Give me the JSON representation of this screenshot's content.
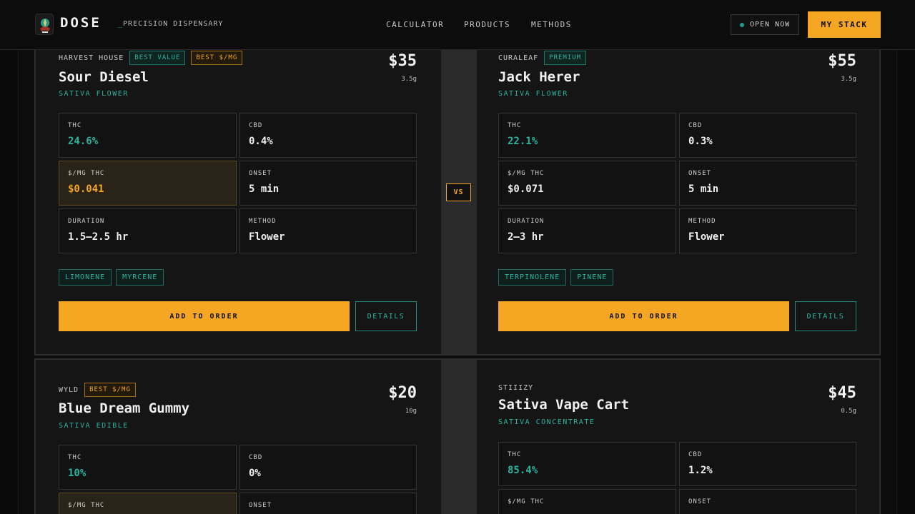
{
  "header": {
    "brand": "DOSE",
    "tagline_prefix": "_",
    "tagline": "PRECISION DISPENSARY",
    "nav": [
      "CALCULATOR",
      "PRODUCTS",
      "METHODS"
    ],
    "status": "OPEN NOW",
    "cta": "MY STACK"
  },
  "vs_label": "VS",
  "comparisons": [
    {
      "left": {
        "brand": "HARVEST HOUSE",
        "badges": [
          "BEST VALUE",
          "BEST $/MG"
        ],
        "name": "Sour Diesel",
        "category": "SATIVA FLOWER",
        "price": "$35",
        "weight": "3.5g",
        "stats": [
          {
            "label": "THC",
            "value": "24.6%"
          },
          {
            "label": "CBD",
            "value": "0.4%"
          },
          {
            "label": "$/MG THC",
            "value": "$0.041"
          },
          {
            "label": "ONSET",
            "value": "5 min"
          },
          {
            "label": "DURATION",
            "value": "1.5–2.5 hr"
          },
          {
            "label": "METHOD",
            "value": "Flower"
          }
        ],
        "terpenes": [
          "LIMONENE",
          "MYRCENE"
        ],
        "add_label": "ADD TO ORDER",
        "details_label": "DETAILS"
      },
      "right": {
        "brand": "CURALEAF",
        "badges": [
          "PREMIUM"
        ],
        "name": "Jack Herer",
        "category": "SATIVA FLOWER",
        "price": "$55",
        "weight": "3.5g",
        "stats": [
          {
            "label": "THC",
            "value": "22.1%"
          },
          {
            "label": "CBD",
            "value": "0.3%"
          },
          {
            "label": "$/MG THC",
            "value": "$0.071"
          },
          {
            "label": "ONSET",
            "value": "5 min"
          },
          {
            "label": "DURATION",
            "value": "2–3 hr"
          },
          {
            "label": "METHOD",
            "value": "Flower"
          }
        ],
        "terpenes": [
          "TERPINOLENE",
          "PINENE"
        ],
        "add_label": "ADD TO ORDER",
        "details_label": "DETAILS"
      }
    },
    {
      "left": {
        "brand": "WYLD",
        "badges": [
          "BEST $/MG"
        ],
        "name": "Blue Dream Gummy",
        "category": "SATIVA EDIBLE",
        "price": "$20",
        "weight": "10g",
        "stats": [
          {
            "label": "THC",
            "value": "10%"
          },
          {
            "label": "CBD",
            "value": "0%"
          },
          {
            "label": "$/MG THC",
            "value": ""
          },
          {
            "label": "ONSET",
            "value": ""
          }
        ]
      },
      "right": {
        "brand": "STIIIZY",
        "name": "Sativa Vape Cart",
        "category": "SATIVA CONCENTRATE",
        "price": "$45",
        "weight": "0.5g",
        "stats": [
          {
            "label": "THC",
            "value": "85.4%"
          },
          {
            "label": "CBD",
            "value": "1.2%"
          },
          {
            "label": "$/MG THC",
            "value": ""
          },
          {
            "label": "ONSET",
            "value": ""
          }
        ]
      }
    }
  ],
  "colors": {
    "accent": "#f5a623",
    "teal": "#2bb3a0",
    "background": "#0c0c0c",
    "card": "#151515"
  },
  "icons": {
    "logo": "cannabis-leaf-emblem-icon",
    "status": "status-dot-icon"
  }
}
